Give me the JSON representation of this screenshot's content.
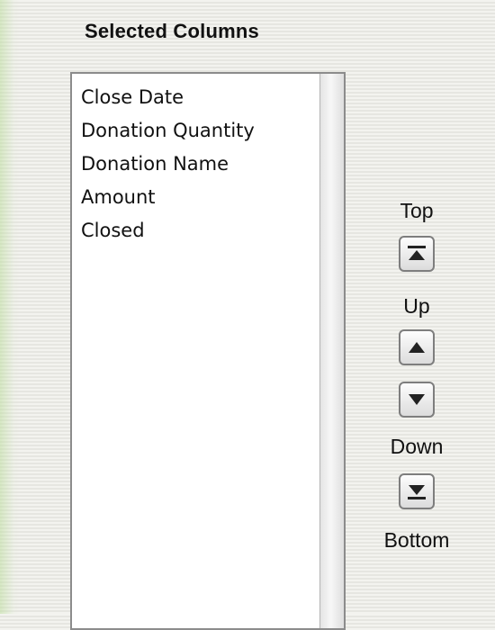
{
  "header": {
    "title": "Selected Columns"
  },
  "columns": [
    "Close Date",
    "Donation Quantity",
    "Donation Name",
    "Amount",
    "Closed"
  ],
  "controls": {
    "top_label": "Top",
    "up_label": "Up",
    "down_label": "Down",
    "bottom_label": "Bottom"
  }
}
